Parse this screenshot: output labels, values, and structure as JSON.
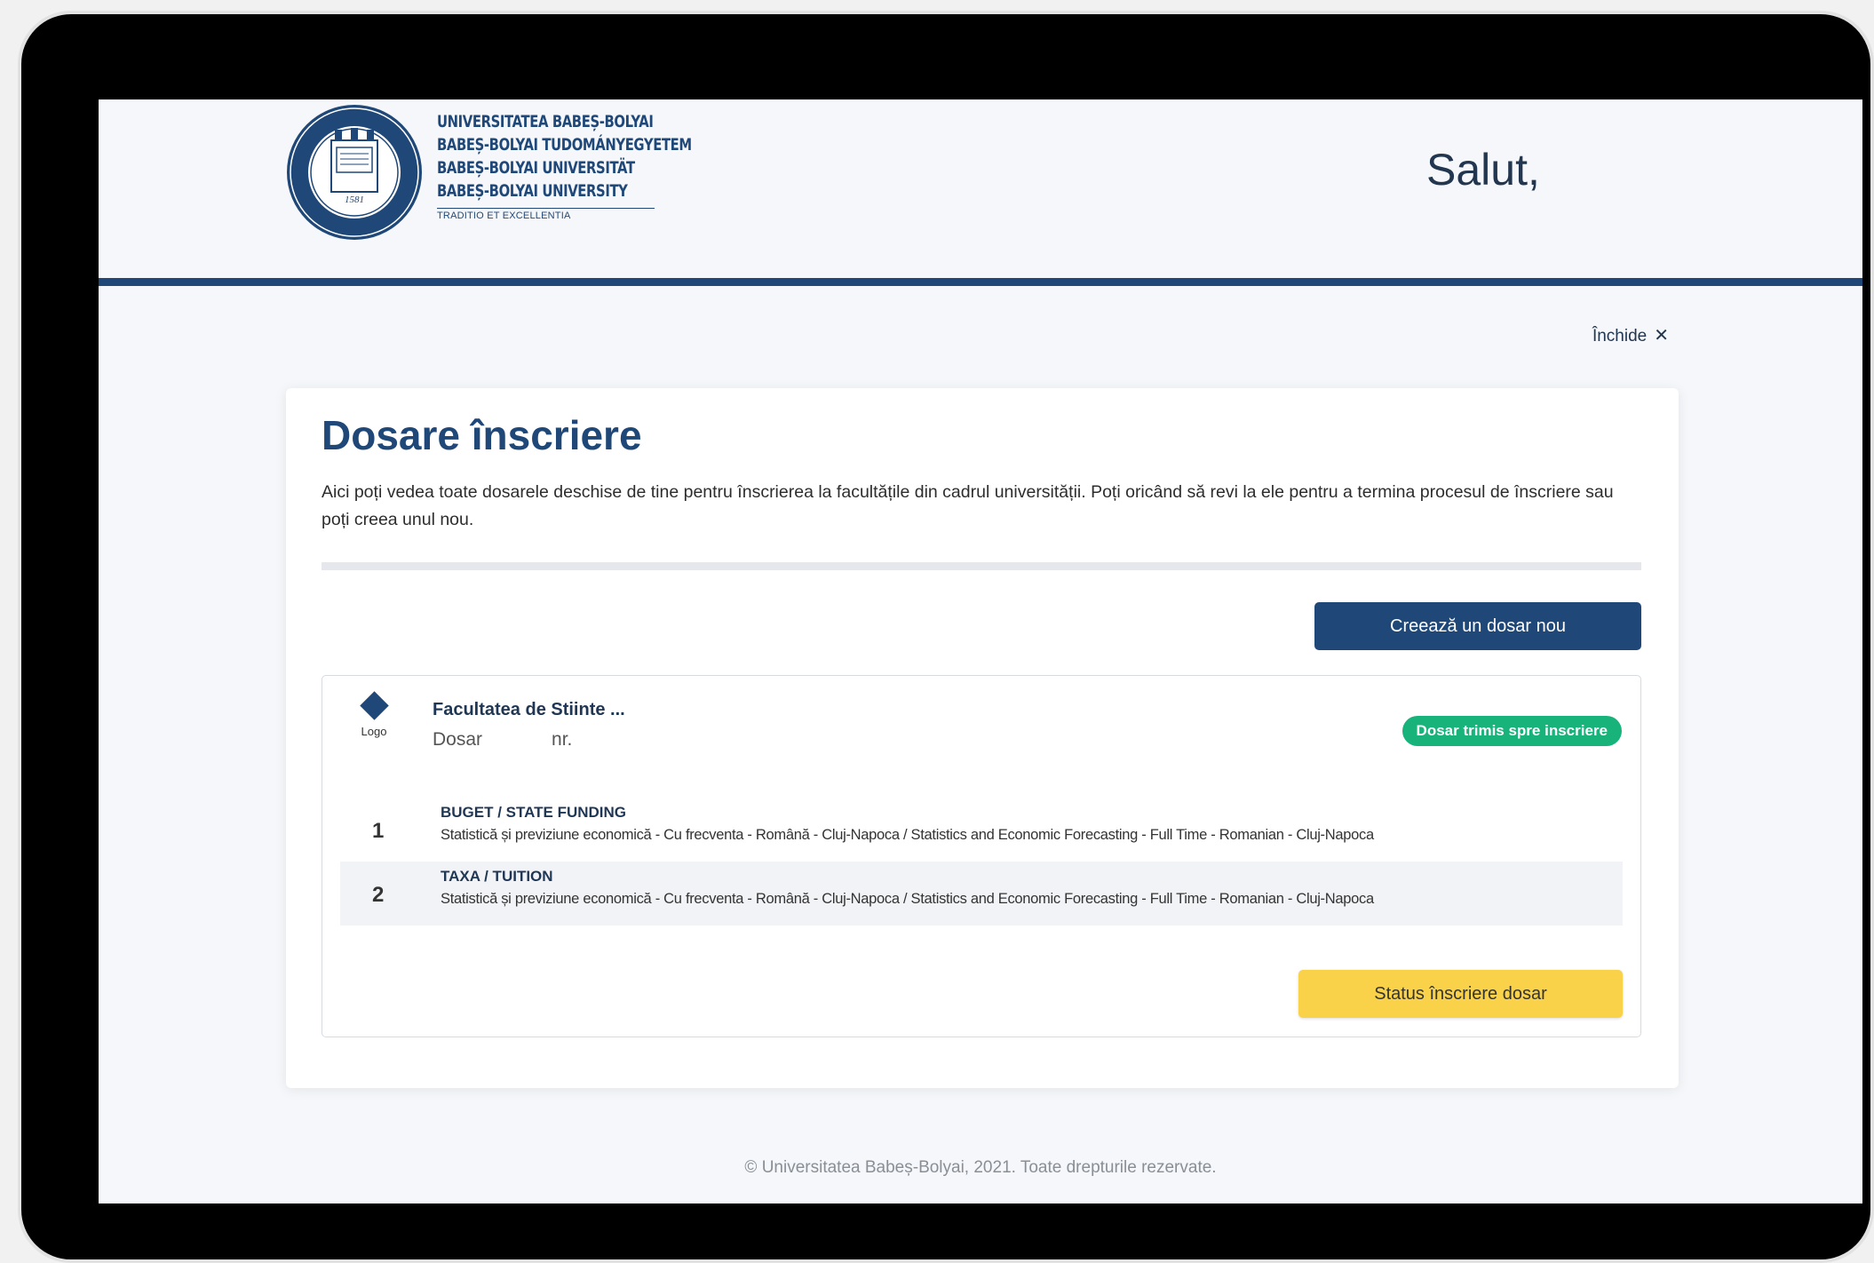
{
  "header": {
    "university_lines": [
      "UNIVERSITATEA BABEȘ-BOLYAI",
      "BABEȘ-BOLYAI TUDOMÁNYEGYETEM",
      "BABEȘ-BOLYAI UNIVERSITÄT",
      "BABEȘ-BOLYAI UNIVERSITY"
    ],
    "motto": "TRADITIO ET EXCELLENTIA",
    "seal_year": "1581",
    "greeting": "Salut,"
  },
  "close": {
    "label": "Închide",
    "icon": "close-icon"
  },
  "card": {
    "title": "Dosare înscriere",
    "description": "Aici poți vedea toate dosarele deschise de tine pentru înscrierea la facultățile din cadrul universității. Poți oricând să revi la ele pentru a termina procesul de înscriere sau poți creea unul nou.",
    "create_button": "Creează un dosar nou"
  },
  "dossier": {
    "logo_label": "Logo",
    "faculty": "Facultatea de Stiinte ...",
    "dosar_label": "Dosar",
    "nr_label": "nr.",
    "status": "Dosar trimis spre inscriere",
    "status_color": "#17b37b",
    "options": [
      {
        "number": "1",
        "title": "BUGET / STATE FUNDING",
        "description": "Statistică și previziune economică - Cu frecventa - Română - Cluj-Napoca / Statistics and Economic Forecasting - Full Time - Romanian - Cluj-Napoca"
      },
      {
        "number": "2",
        "title": "TAXA / TUITION",
        "description": "Statistică și previziune economică - Cu frecventa - Română - Cluj-Napoca / Statistics and Economic Forecasting - Full Time - Romanian - Cluj-Napoca"
      }
    ],
    "status_button": "Status înscriere dosar"
  },
  "footer": "© Universitatea Babeș-Bolyai, 2021. Toate drepturile rezervate.",
  "colors": {
    "primary": "#1f4878",
    "accent_yellow": "#f9d24a",
    "success_green": "#17b37b"
  }
}
